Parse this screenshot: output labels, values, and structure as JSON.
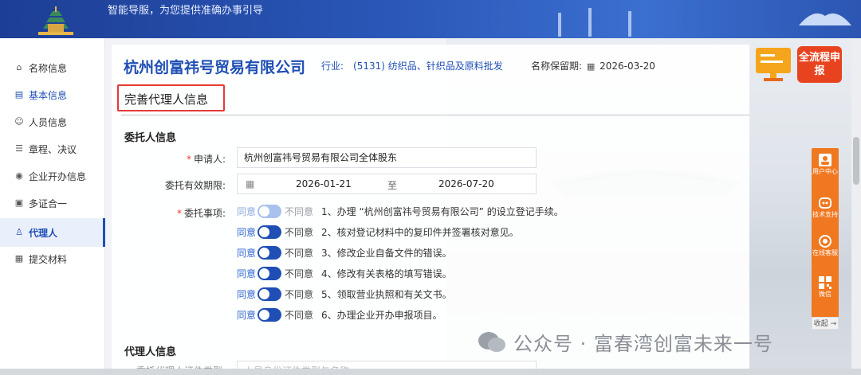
{
  "header": {
    "slogan": "智能导服，为您提供准确办事引导"
  },
  "sidebar": {
    "items": [
      {
        "label": "名称信息",
        "icon": "house-icon"
      },
      {
        "label": "基本信息",
        "icon": "doc-icon"
      },
      {
        "label": "人员信息",
        "icon": "people-icon"
      },
      {
        "label": "章程、决议",
        "icon": "file-icon"
      },
      {
        "label": "企业开办信息",
        "icon": "shield-icon"
      },
      {
        "label": "多证合一",
        "icon": "copy-icon"
      },
      {
        "label": "代理人",
        "icon": "agent-icon"
      },
      {
        "label": "提交材料",
        "icon": "upload-icon"
      }
    ],
    "active_index": 6
  },
  "company": {
    "name": "杭州创富祎号贸易有限公司",
    "industry": "行业:　(5131) 纺织品、针织品及原料批发",
    "reserve_label": "名称保留期:",
    "reserve_date": "2026-03-20"
  },
  "page": {
    "section_title": "完善代理人信息",
    "group_principal": "委托人信息",
    "group_agent": "代理人信息"
  },
  "form": {
    "applicant_label": "申请人:",
    "applicant_value": "杭州创富祎号贸易有限公司全体股东",
    "period_label": "委托有效期限:",
    "period_start": "2026-01-21",
    "period_sep": "至",
    "period_end": "2026-07-20",
    "matters_label": "委托事项:",
    "yes_label": "同意",
    "no_label": "不同意",
    "agent_cert_label": "委托代理人证件类型:",
    "agent_cert_placeholder": "人员身份证件类型与名称"
  },
  "matters": [
    "1、办理 “杭州创富祎号贸易有限公司” 的设立登记手续。",
    "2、核对登记材料中的复印件并签署核对意见。",
    "3、修改企业自备文件的错误。",
    "4、修改有关表格的填写错误。",
    "5、领取营业执照和有关文书。",
    "6、办理企业开办申报项目。"
  ],
  "floatbar": {
    "items": [
      "用户中心",
      "技术支持",
      "在线客服",
      "微信"
    ],
    "collapse": "收起 →"
  },
  "full_process_button": "全流程申报",
  "watermark": "公众号 · 富春湾创富未来一号",
  "colors": {
    "accent": "#1f4fb5",
    "alert": "#e53935",
    "orange": "#f07820"
  }
}
